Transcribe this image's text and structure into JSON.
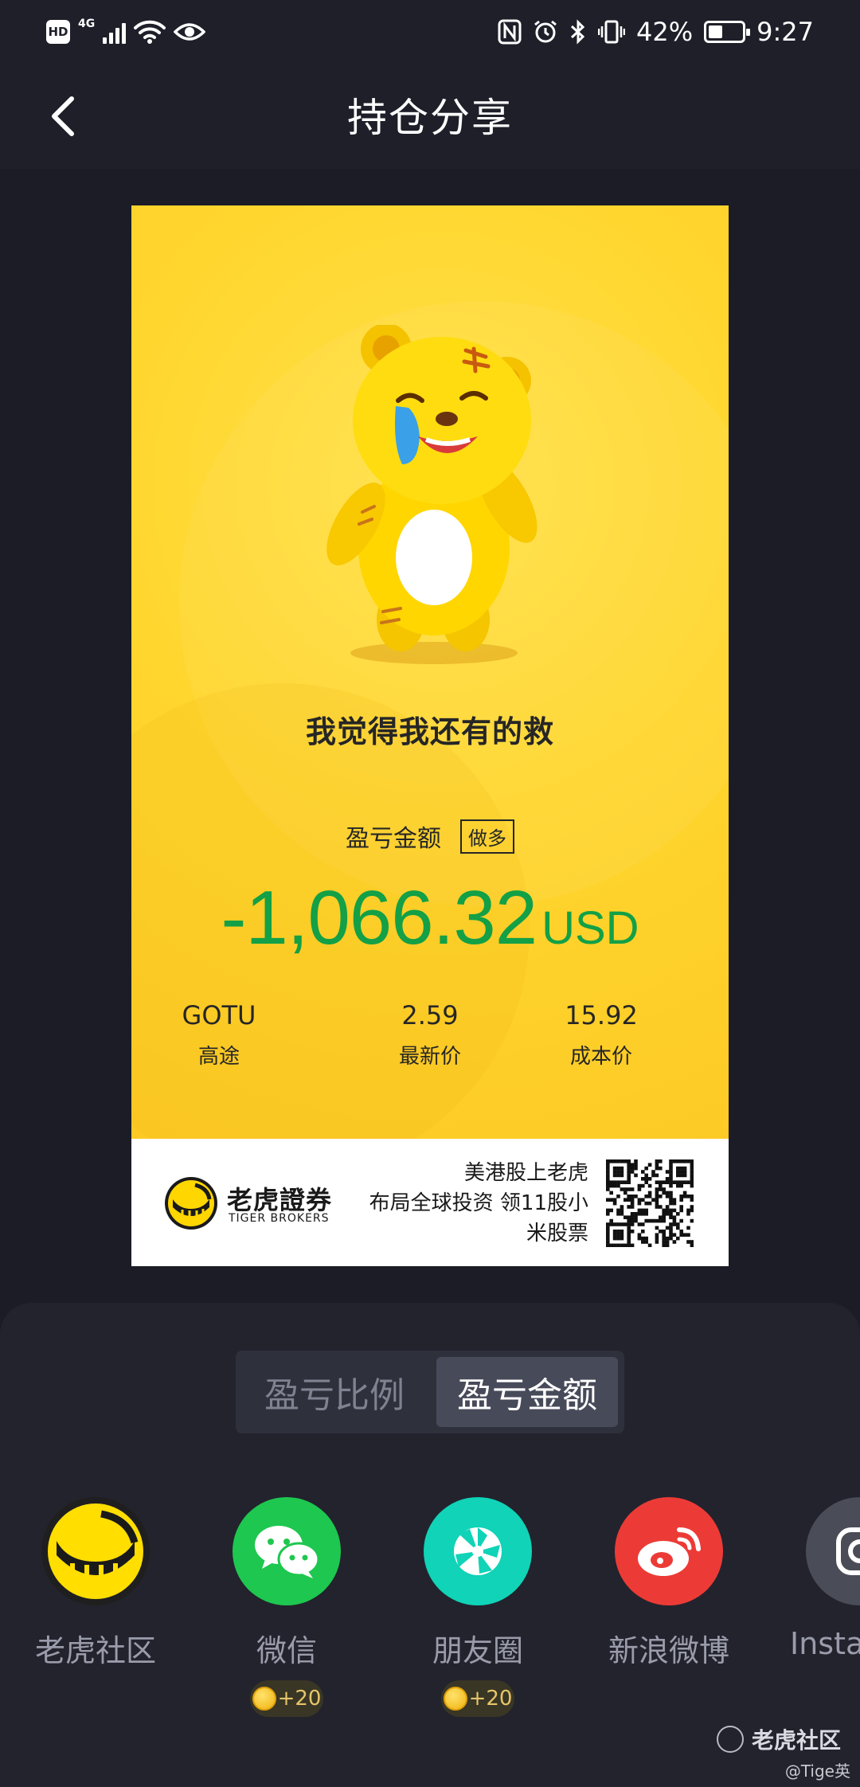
{
  "status_bar": {
    "hd": "HD",
    "network": "4G",
    "battery_text": "42%",
    "battery_level": 0.42,
    "time": "9:27"
  },
  "header": {
    "title": "持仓分享"
  },
  "card": {
    "slogan": "我觉得我还有的救",
    "pl_label": "盈亏金额",
    "position_tag": "做多",
    "amount": "-1,066.32",
    "currency": "USD",
    "amount_color": "#13a046",
    "stats": [
      {
        "value": "GOTU",
        "label": "高途"
      },
      {
        "value": "2.59",
        "label": "最新价"
      },
      {
        "value": "15.92",
        "label": "成本价"
      }
    ],
    "footer": {
      "brand_cn": "老虎證券",
      "brand_en": "TIGER BROKERS",
      "promo_lines": [
        "美港股上老虎",
        "布局全球投资 领11股小",
        "米股票"
      ]
    }
  },
  "segmented": {
    "options": [
      "盈亏比例",
      "盈亏金额"
    ],
    "selected": "盈亏金额"
  },
  "share_targets": [
    {
      "label": "老虎社区",
      "icon": "tiger-community-icon",
      "color": "#ffde00",
      "reward": ""
    },
    {
      "label": "微信",
      "icon": "wechat-icon",
      "color": "#1ec74f",
      "reward": "+20"
    },
    {
      "label": "朋友圈",
      "icon": "moments-icon",
      "color": "#10d3b7",
      "reward": "+20"
    },
    {
      "label": "新浪微博",
      "icon": "weibo-icon",
      "color": "#ec3b36",
      "reward": ""
    },
    {
      "label": "Insta",
      "icon": "instagram-icon",
      "color": "#4a4c57",
      "reward": ""
    }
  ],
  "watermark": {
    "text": "老虎社区",
    "user": "@Tige英"
  }
}
